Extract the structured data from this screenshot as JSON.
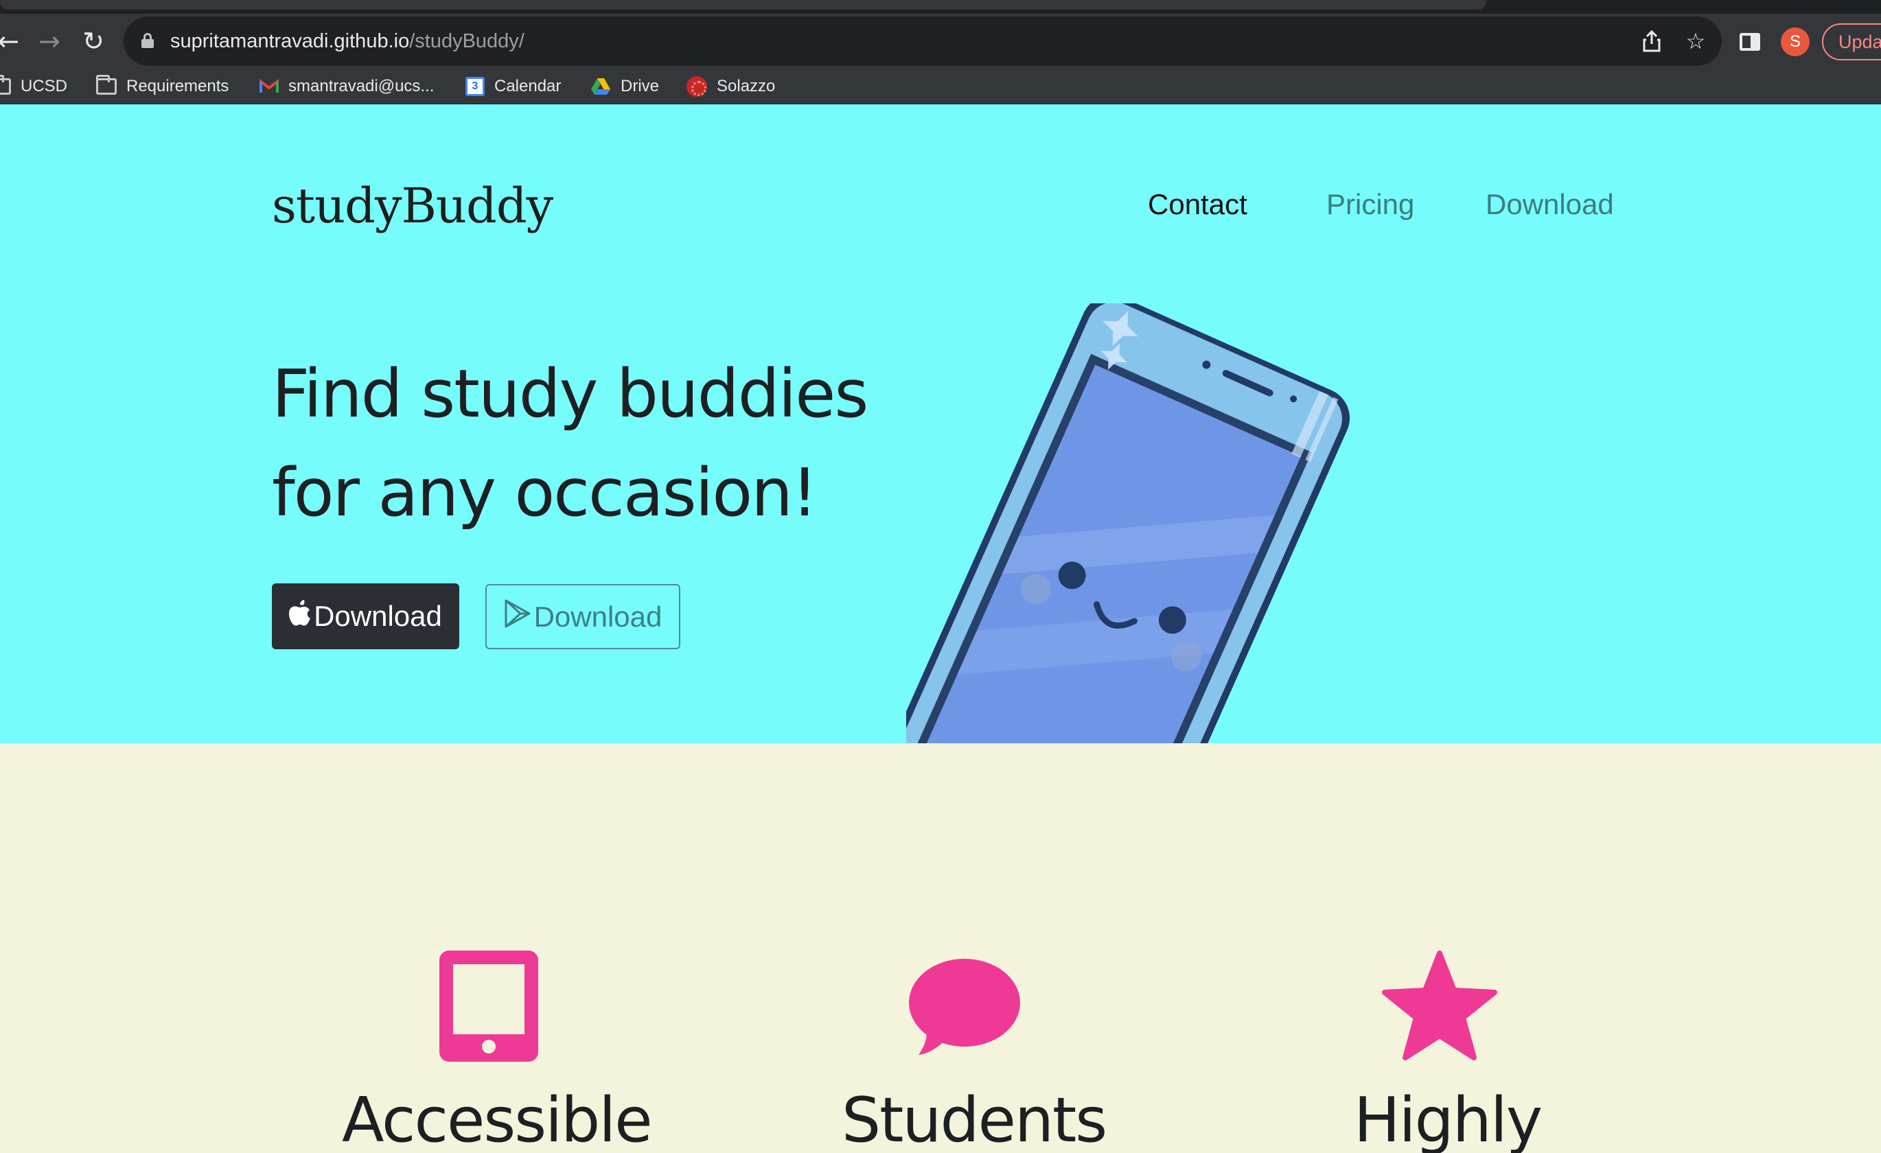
{
  "browser": {
    "url_host": "supritamantravadi.github.io",
    "url_path": "/studyBuddy/",
    "avatar_letter": "S",
    "update_label": "Upda",
    "bookmarks": [
      {
        "label": "UCSD",
        "icon": "folder-icon"
      },
      {
        "label": "Requirements",
        "icon": "folder-icon"
      },
      {
        "label": "smantravadi@ucs...",
        "icon": "gmail-icon"
      },
      {
        "label": "Calendar",
        "icon": "calendar-icon"
      },
      {
        "label": "Drive",
        "icon": "drive-icon"
      },
      {
        "label": "Solazzo",
        "icon": "solazzo-icon"
      }
    ],
    "calendar_day": "3"
  },
  "header": {
    "brand": "studyBuddy",
    "nav": [
      {
        "label": "Contact"
      },
      {
        "label": "Pricing"
      },
      {
        "label": "Download"
      }
    ]
  },
  "hero": {
    "headline": "Find study buddies for any occasion!",
    "apple_button": "Download",
    "play_button": "Download"
  },
  "features": [
    {
      "title": "Accessible",
      "icon": "tablet-icon"
    },
    {
      "title": "Students",
      "icon": "chat-bubble-icon"
    },
    {
      "title": "Highly",
      "icon": "star-icon"
    }
  ],
  "colors": {
    "hero_bg": "#77fcfc",
    "features_bg": "#f4f3dc",
    "accent_pink": "#ee3a95",
    "dark_button": "#2b2f35"
  }
}
